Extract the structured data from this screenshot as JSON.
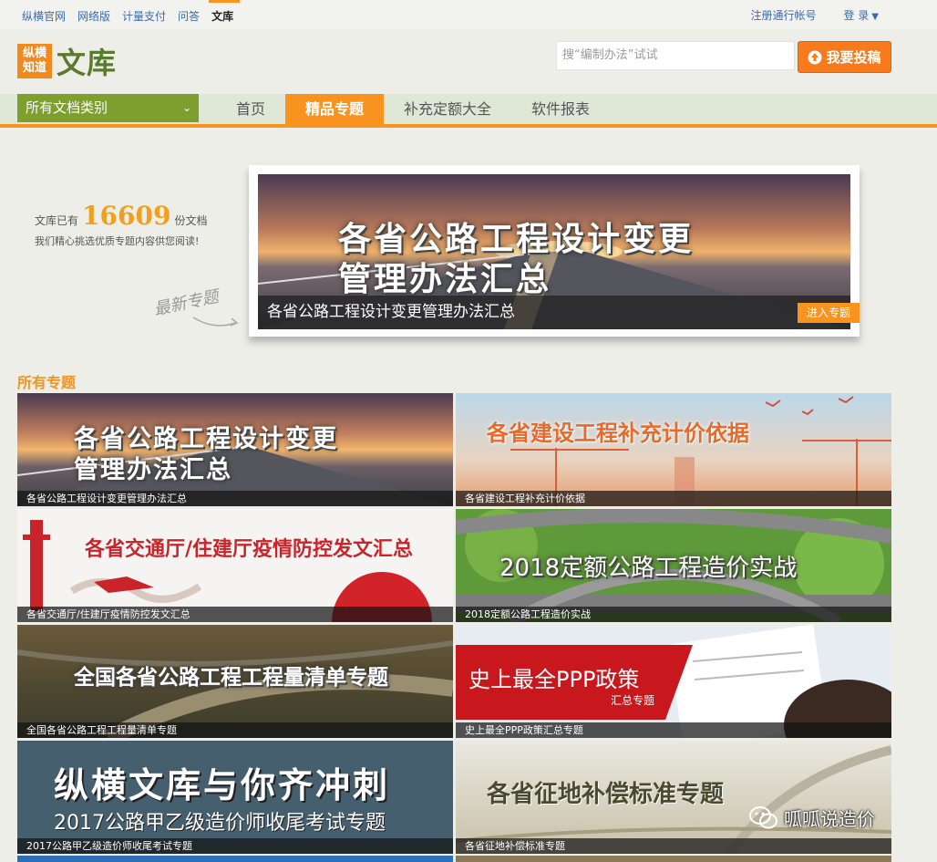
{
  "topbar": {
    "links": [
      "纵横官网",
      "网络版",
      "计量支付",
      "问答",
      "文库"
    ],
    "active_link": "文库",
    "register": "注册通行帐号",
    "login": "登 录"
  },
  "header": {
    "logo_badge_line1": "纵横",
    "logo_badge_line2": "知道",
    "logo_text": "文库",
    "search_placeholder": "搜“编制办法”试试",
    "upload_label": "我要投稿"
  },
  "nav": {
    "category_label": "所有文档类别",
    "tabs": [
      "首页",
      "精品专题",
      "补充定额大全",
      "软件报表"
    ],
    "active_tab": "精品专题"
  },
  "intro": {
    "prefix": "文库已有",
    "count": "16609",
    "suffix": "份文档",
    "tagline": "我们精心挑选优质专题内容供您阅读!",
    "latest_label": "最新专题"
  },
  "featured": {
    "banner_line1": "各省公路工程设计变更",
    "banner_line2": "管理办法汇总",
    "caption": "各省公路工程设计变更管理办法汇总",
    "enter_label": "进入专题"
  },
  "section": {
    "title": "所有专题"
  },
  "cards": [
    {
      "caption": "各省公路工程设计变更管理办法汇总",
      "banner_line1": "各省公路工程设计变更",
      "banner_line2": "管理办法汇总"
    },
    {
      "caption": "各省建设工程补充计价依据",
      "banner_line1": "各省建设工程补充计价依据",
      "banner_line2": ""
    },
    {
      "caption": "各省交通厅/住建厅疫情防控发文汇总",
      "banner_line1": "各省交通厅/住建厅疫情防控发文汇总",
      "banner_line2": ""
    },
    {
      "caption": "2018定额公路工程造价实战",
      "banner_line1": "2018定额公路工程造价实战",
      "banner_line2": ""
    },
    {
      "caption": "全国各省公路工程工程量清单专题",
      "banner_line1": "全国各省公路工程工程量清单专题",
      "banner_line2": ""
    },
    {
      "caption": "史上最全PPP政策汇总专题",
      "banner_line1": "史上最全PPP政策",
      "banner_line2": "汇总专题"
    },
    {
      "caption": "2017公路甲乙级造价师收尾考试专题",
      "banner_line1": "纵横文库与你齐冲刺",
      "banner_line2": "2017公路甲乙级造价师收尾考试专题"
    },
    {
      "caption": "各省征地补偿标准专题",
      "banner_line1": "各省征地补偿标准专题",
      "banner_line2": ""
    }
  ],
  "watermark": "呱呱说造价",
  "colors": {
    "accent_orange": "#f7931e",
    "category_green": "#7e9e2e",
    "link_blue": "#3b6ab0"
  }
}
